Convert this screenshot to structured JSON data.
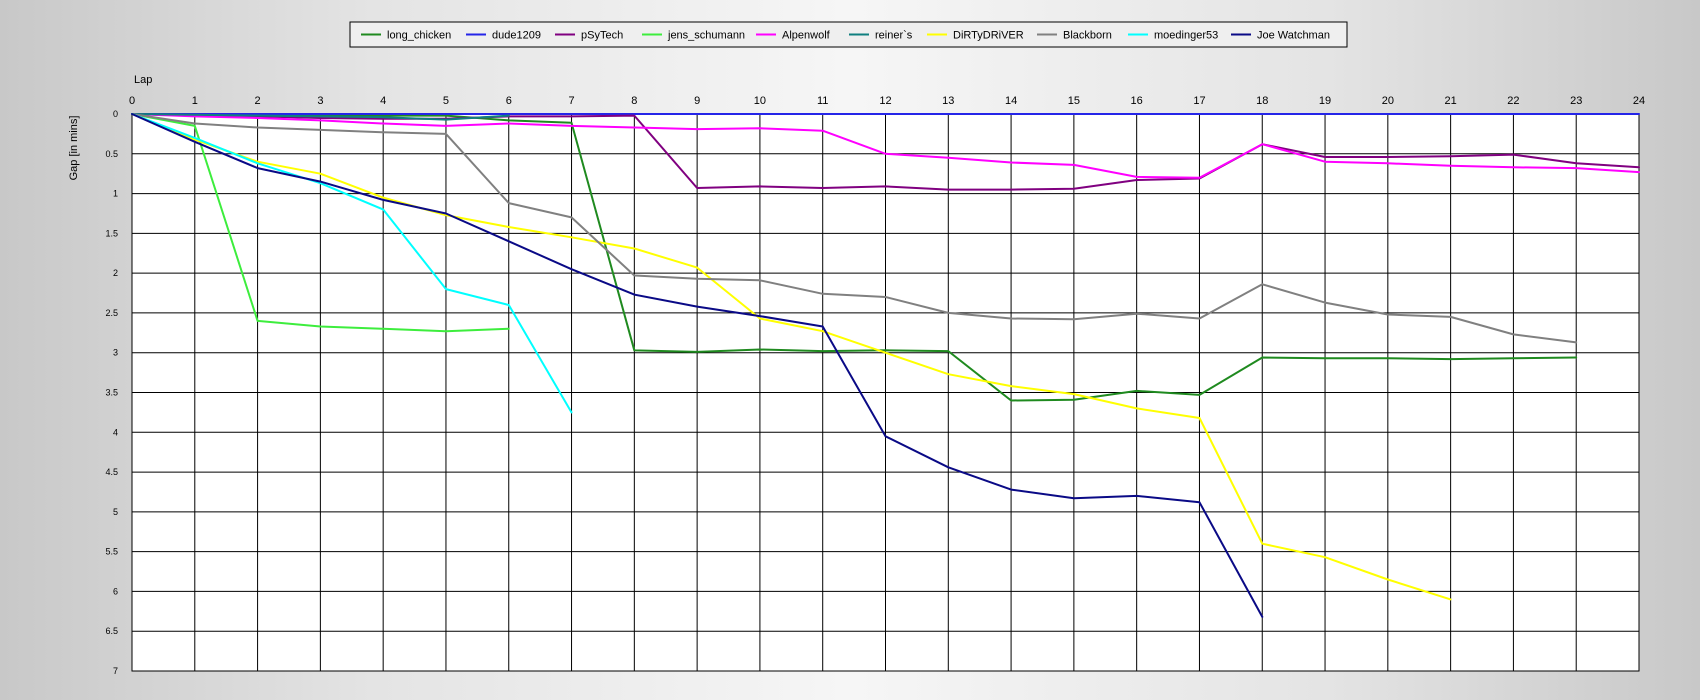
{
  "chart_data": {
    "type": "line",
    "grid": true,
    "legend_position": "top",
    "x_axis": {
      "label": "Lap",
      "position": "top",
      "range": [
        0,
        24
      ],
      "ticks": [
        "0",
        "1",
        "2",
        "3",
        "4",
        "5",
        "6",
        "7",
        "8",
        "9",
        "10",
        "11",
        "12",
        "13",
        "14",
        "15",
        "16",
        "17",
        "18",
        "19",
        "20",
        "21",
        "22",
        "23",
        "24"
      ]
    },
    "y_axis": {
      "label": "Gap [in mins]",
      "direction": "downward",
      "range": [
        0,
        7
      ],
      "ticks": [
        "0",
        "0.5",
        "1",
        "1.5",
        "2",
        "2.5",
        "3",
        "3.5",
        "4",
        "4.5",
        "5",
        "5.5",
        "6",
        "6.5",
        "7"
      ]
    },
    "x": [
      0,
      1,
      2,
      3,
      4,
      5,
      6,
      7,
      8,
      9,
      10,
      11,
      12,
      13,
      14,
      15,
      16,
      17,
      18,
      19,
      20,
      21,
      22,
      23,
      24
    ],
    "series": [
      {
        "name": "long_chicken",
        "color": "#1f8a1f",
        "values": [
          0,
          0.02,
          0.02,
          0.02,
          0.02,
          0.02,
          0.08,
          0.11,
          2.97,
          2.99,
          2.96,
          2.98,
          2.97,
          2.98,
          3.6,
          3.59,
          3.48,
          3.53,
          3.06,
          3.07,
          3.07,
          3.08,
          3.07,
          3.06
        ]
      },
      {
        "name": "dude1209",
        "color": "#2525e8",
        "values": [
          0,
          0,
          0,
          0,
          0,
          0,
          0,
          0,
          0,
          0,
          0,
          0,
          0,
          0,
          0,
          0,
          0,
          0,
          0,
          0,
          0,
          0,
          0,
          0,
          0
        ]
      },
      {
        "name": "pSyTech",
        "color": "#800080",
        "values": [
          0,
          0.02,
          0.03,
          0.05,
          0.06,
          0.06,
          0.03,
          0.03,
          0.02,
          0.93,
          0.91,
          0.93,
          0.91,
          0.95,
          0.95,
          0.94,
          0.83,
          0.81,
          0.38,
          0.54,
          0.54,
          0.53,
          0.51,
          0.62,
          0.67
        ]
      },
      {
        "name": "jens_schumann",
        "color": "#3ded3d",
        "values": [
          0,
          0.15,
          2.6,
          2.67,
          2.7,
          2.73,
          2.7
        ]
      },
      {
        "name": "Alpenwolf",
        "color": "#ff00ff",
        "values": [
          0,
          0.03,
          0.05,
          0.08,
          0.12,
          0.15,
          0.12,
          0.15,
          0.17,
          0.19,
          0.18,
          0.21,
          0.5,
          0.55,
          0.61,
          0.64,
          0.79,
          0.8,
          0.38,
          0.6,
          0.62,
          0.65,
          0.67,
          0.68,
          0.73
        ]
      },
      {
        "name": "reiner`s",
        "color": "#0f7f7f",
        "values": [
          0,
          0.01,
          0.02,
          0.03,
          0.04,
          0.07,
          0.02
        ]
      },
      {
        "name": "DiRTyDRiVER",
        "color": "#ffff00",
        "values": [
          0,
          0.32,
          0.6,
          0.75,
          1.05,
          1.27,
          1.42,
          1.55,
          1.69,
          1.93,
          2.57,
          2.73,
          3.0,
          3.27,
          3.42,
          3.52,
          3.7,
          3.82,
          5.4,
          5.57,
          5.85,
          6.1
        ]
      },
      {
        "name": "Blackborn",
        "color": "#808080",
        "values": [
          0,
          0.12,
          0.17,
          0.2,
          0.23,
          0.25,
          1.12,
          1.3,
          2.03,
          2.07,
          2.09,
          2.26,
          2.3,
          2.5,
          2.57,
          2.58,
          2.51,
          2.57,
          2.14,
          2.37,
          2.52,
          2.55,
          2.77,
          2.87
        ]
      },
      {
        "name": "moedinger53",
        "color": "#00ffff",
        "values": [
          0,
          0.3,
          0.62,
          0.87,
          1.2,
          2.2,
          2.4,
          3.75
        ]
      },
      {
        "name": "Joe Watchman",
        "color": "#0a0a86",
        "values": [
          0,
          0.35,
          0.68,
          0.85,
          1.08,
          1.25,
          1.6,
          1.95,
          2.27,
          2.42,
          2.54,
          2.67,
          4.05,
          4.44,
          4.72,
          4.83,
          4.8,
          4.88,
          6.32
        ]
      }
    ]
  }
}
